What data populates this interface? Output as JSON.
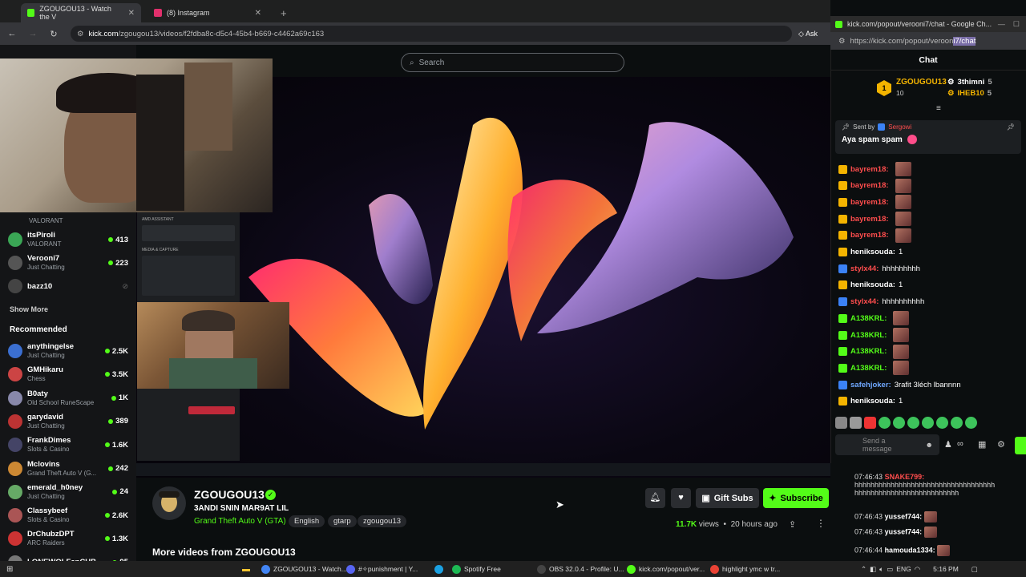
{
  "browser": {
    "tabs": [
      {
        "label": "ZGOUGOU13 - Watch the V",
        "color": "#53fc18"
      },
      {
        "label": "(8) Instagram",
        "color": "#e1306c"
      }
    ],
    "url_host": "kick.com",
    "url_path": "/zgougou13/videos/f2fdba8c-d5c4-45b4-b669-c4462a69c163",
    "ask_label": "Ask"
  },
  "kick": {
    "search_placeholder": "Search",
    "sidebar": {
      "following": [
        {
          "name": "itsPiroli",
          "category": "VALORANT",
          "count": "413",
          "color": "#3aa655"
        },
        {
          "name": "Verooni7",
          "category": "Just Chatting",
          "count": "223",
          "color": "#555"
        },
        {
          "name": "bazz10",
          "category": "",
          "count": "",
          "color": "#444"
        }
      ],
      "partial_category": "VALORANT",
      "show_more": "Show More",
      "recommended_title": "Recommended",
      "recommended": [
        {
          "name": "anythingelse",
          "category": "Just Chatting",
          "count": "2.5K",
          "color": "#3b6fd1"
        },
        {
          "name": "GMHikaru",
          "category": "Chess",
          "count": "3.5K",
          "color": "#c44"
        },
        {
          "name": "B0aty",
          "category": "Old School RuneScape",
          "count": "1K",
          "color": "#88a"
        },
        {
          "name": "garydavid",
          "category": "Just Chatting",
          "count": "389",
          "color": "#b33"
        },
        {
          "name": "FrankDimes",
          "category": "Slots & Casino",
          "count": "1.6K",
          "color": "#446"
        },
        {
          "name": "Mclovins",
          "category": "Grand Theft Auto V (G...",
          "count": "242",
          "color": "#cc8833"
        },
        {
          "name": "emerald_h0ney",
          "category": "Just Chatting",
          "count": "24",
          "color": "#6a6"
        },
        {
          "name": "Classybeef",
          "category": "Slots & Casino",
          "count": "2.6K",
          "color": "#a55"
        },
        {
          "name": "DrChubzDPT",
          "category": "ARC Raiders",
          "count": "1.3K",
          "color": "#c33"
        },
        {
          "name": "LONEWOLFanCUB",
          "category": "",
          "count": "95",
          "color": "#777"
        }
      ]
    },
    "channel": {
      "name": "ZGOUGOU13",
      "title": "3ANDI SNIN MAR9AT LIL",
      "game": "Grand Theft Auto V (GTA)",
      "tags": [
        "English",
        "gtarp",
        "zgougou13"
      ],
      "gift_subs": "Gift Subs",
      "subscribe": "Subscribe",
      "views": "11.7K",
      "views_label": "views",
      "age": "20 hours ago",
      "more_videos": "More videos from ZGOUGOU13"
    }
  },
  "chat": {
    "window_title": "kick.com/popout/verooni7/chat - Google Ch...",
    "url_prefix": "https://kick.com/popout/veroon",
    "url_selected": "i7/chat",
    "header": "Chat",
    "leaders": {
      "first": {
        "name": "ZGOUGOU13",
        "amount": "10"
      },
      "second": {
        "name": "3thimni",
        "amount": "5"
      },
      "third": {
        "name": "IHEB10",
        "amount": "5"
      },
      "rank": "1"
    },
    "pinned": {
      "sent_by_label": "Sent by",
      "sender": "Sergowi",
      "text": "Aya spam spam"
    },
    "messages": [
      {
        "user": "bayrem18:",
        "text": "",
        "color": "#ff4d4d",
        "emote": true
      },
      {
        "user": "bayrem18:",
        "text": "",
        "color": "#ff4d4d",
        "emote": true
      },
      {
        "user": "bayrem18:",
        "text": "",
        "color": "#ff4d4d",
        "emote": true
      },
      {
        "user": "bayrem18:",
        "text": "",
        "color": "#ff4d4d",
        "emote": true
      },
      {
        "user": "bayrem18:",
        "text": "",
        "color": "#ff4d4d",
        "emote": true
      },
      {
        "user": "heniksouda:",
        "text": "1",
        "color": "#ffffff",
        "emote": false
      },
      {
        "user": "stylx44:",
        "text": "hhhhhhhhh",
        "color": "#ff4d4d",
        "emote": false
      },
      {
        "user": "heniksouda:",
        "text": "1",
        "color": "#ffffff",
        "emote": false
      },
      {
        "user": "stylx44:",
        "text": "hhhhhhhhhh",
        "color": "#ff4d4d",
        "emote": false
      },
      {
        "user": "A138KRL:",
        "text": "",
        "color": "#53fc18",
        "emote": true
      },
      {
        "user": "A138KRL:",
        "text": "",
        "color": "#53fc18",
        "emote": true
      },
      {
        "user": "A138KRL:",
        "text": "",
        "color": "#53fc18",
        "emote": true
      },
      {
        "user": "A138KRL:",
        "text": "",
        "color": "#53fc18",
        "emote": true
      },
      {
        "user": "safehjoker:",
        "text": "3rafit 3léch lbannnn",
        "color": "#6fa8ff",
        "emote": false
      },
      {
        "user": "heniksouda:",
        "text": "1",
        "color": "#ffffff",
        "emote": false
      }
    ],
    "input_placeholder": "Send a message",
    "bottom_messages": [
      {
        "time": "07:46:43",
        "user": "SNAKE799:",
        "text": "hhhhhhhhhhhhhhhhhhhhhhhhhhhhhhhhhhh",
        "text2": "hhhhhhhhhhhhhhhhhhhhhhhhhh",
        "color": "#ff4d4d"
      },
      {
        "time": "07:46:43",
        "user": "yussef744:",
        "text": "",
        "text2": "",
        "color": "#ffffff"
      },
      {
        "time": "07:46:43",
        "user": "yussef744:",
        "text": "",
        "text2": "",
        "color": "#ffffff"
      },
      {
        "time": "07:46:44",
        "user": "hamouda1334:",
        "text": "",
        "text2": "",
        "color": "#ffffff"
      }
    ]
  },
  "taskbar": {
    "items": [
      {
        "label": "ZGOUGOU13 - Watch...",
        "color": "#4285f4"
      },
      {
        "label": "#✧punishment | Y...",
        "color": "#5865f2"
      },
      {
        "label": "Spotify Free",
        "color": "#1db954"
      },
      {
        "label": "OBS 32.0.4 - Profile: U...",
        "color": "#444"
      },
      {
        "label": "kick.com/popout/ver...",
        "color": "#53fc18"
      },
      {
        "label": "highlight ymc w tr...",
        "color": "#ea4335"
      }
    ],
    "lang": "ENG",
    "time": "5:16 PM"
  }
}
